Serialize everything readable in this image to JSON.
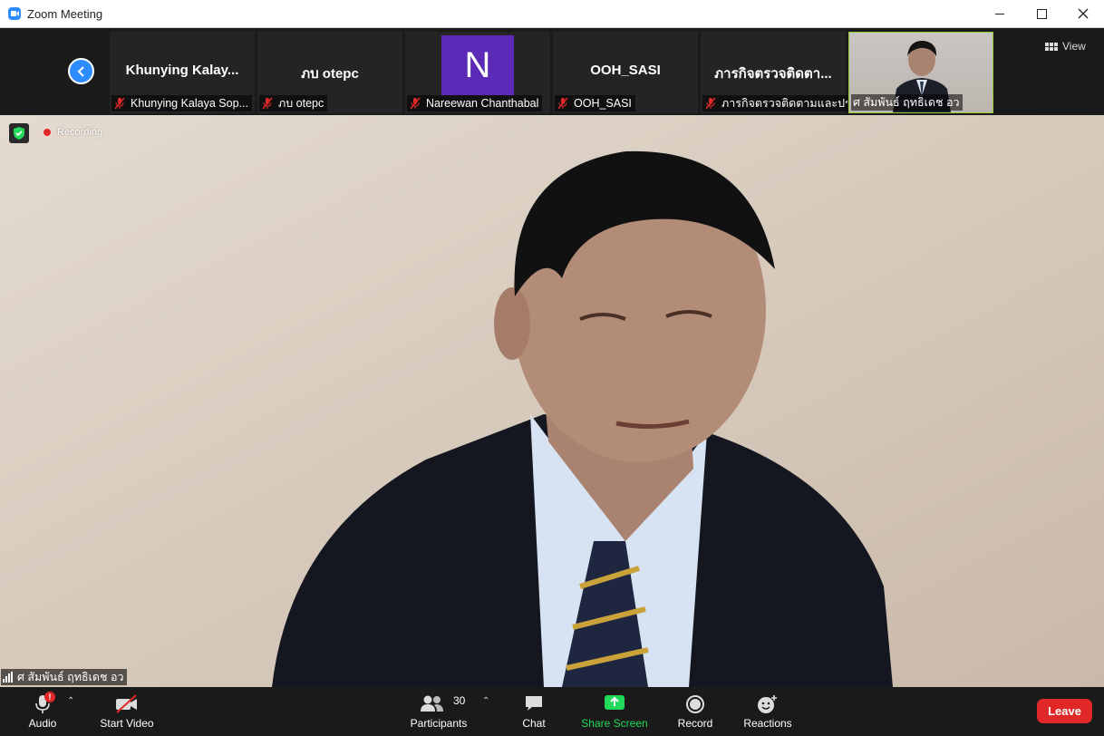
{
  "window": {
    "title": "Zoom Meeting",
    "app_icon": "zoom-logo-icon",
    "controls": [
      "minimize",
      "maximize",
      "close"
    ]
  },
  "gallery": {
    "view_label": "View",
    "tiles": [
      {
        "name": "Khunying  Kalay...",
        "label": "Khunying Kalaya Sop...",
        "muted": true
      },
      {
        "name": "ภบ otepc",
        "label": "ภบ otepc",
        "muted": true
      },
      {
        "name": "",
        "avatar_letter": "N",
        "avatar_color": "#5b2bb7",
        "label": "Nareewan Chanthabal",
        "muted": true
      },
      {
        "name": "OOH_SASI",
        "label": "OOH_SASI",
        "muted": true
      },
      {
        "name": "ภารกิจตรวจติดตา...",
        "label": "ภารกิจตรวจติดตามและปร...",
        "muted": true
      },
      {
        "name": "",
        "label": "ศ สัมพันธ์ ฤทธิเดช อว",
        "muted": false,
        "active_speaker": true
      }
    ]
  },
  "main": {
    "recording_label": "Recording",
    "speaker_name": "ศ สัมพันธ์ ฤทธิเดช อว"
  },
  "toolbar": {
    "audio": "Audio",
    "start_video": "Start Video",
    "participants": "Participants",
    "participants_count": "30",
    "chat": "Chat",
    "share_screen": "Share Screen",
    "record": "Record",
    "reactions": "Reactions",
    "leave": "Leave",
    "audio_badge": "!"
  },
  "colors": {
    "accent": "#2D8CFF",
    "share_green": "#23d959",
    "leave_red": "#e02828",
    "active_border": "#9ccc39"
  }
}
